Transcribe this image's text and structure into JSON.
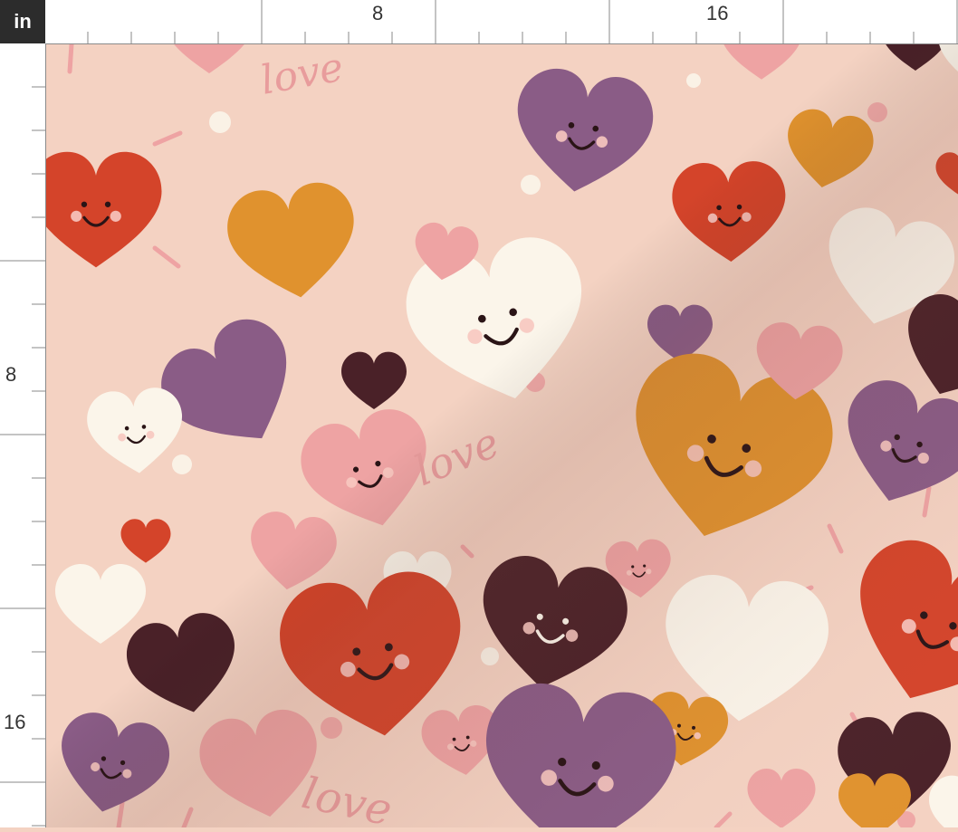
{
  "ruler": {
    "unit": "in",
    "top_labels": [
      "8",
      "16"
    ],
    "left_labels": [
      "8",
      "16"
    ]
  },
  "pattern": {
    "word": "love",
    "background": "#f4d2c2",
    "palette": {
      "red": "#d4442a",
      "orange": "#e0922e",
      "purple": "#8a5c86",
      "cream": "#fbf5ea",
      "pink": "#eea3a3",
      "brown": "#4a2128",
      "face": "#2a1416",
      "blush": "#f7c8c0"
    },
    "icons": [
      "heart-icon",
      "smiley-face-icon",
      "dot-icon",
      "dash-icon"
    ]
  }
}
